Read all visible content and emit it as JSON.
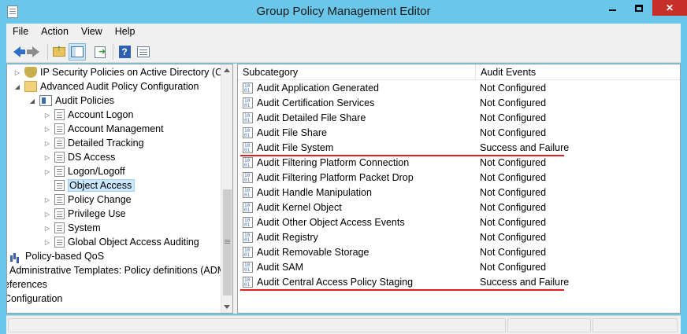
{
  "window": {
    "title": "Group Policy Management Editor"
  },
  "menu": [
    "File",
    "Action",
    "View",
    "Help"
  ],
  "toolbar": {
    "icons": [
      "back-arrow-icon",
      "forward-arrow-icon",
      "up-folder-icon",
      "show-hide-tree-icon",
      "export-list-icon",
      "help-icon",
      "properties-icon"
    ]
  },
  "tree": {
    "items": [
      {
        "label": "IP Security Policies on Active Directory (CO",
        "icon": "shield-icon",
        "expander": "▷"
      },
      {
        "label": "Advanced Audit Policy Configuration",
        "icon": "folder-icon",
        "expander": "◢"
      },
      {
        "label": "Audit Policies",
        "icon": "policy-icon",
        "expander": "◢"
      },
      {
        "label": "Account Logon",
        "icon": "document-icon",
        "expander": "▷"
      },
      {
        "label": "Account Management",
        "icon": "document-icon",
        "expander": "▷"
      },
      {
        "label": "Detailed Tracking",
        "icon": "document-icon",
        "expander": "▷"
      },
      {
        "label": "DS Access",
        "icon": "document-icon",
        "expander": "▷"
      },
      {
        "label": "Logon/Logoff",
        "icon": "document-icon",
        "expander": "▷"
      },
      {
        "label": "Object Access",
        "icon": "document-icon",
        "expander": ""
      },
      {
        "label": "Policy Change",
        "icon": "document-icon",
        "expander": "▷"
      },
      {
        "label": "Privilege Use",
        "icon": "document-icon",
        "expander": "▷"
      },
      {
        "label": "System",
        "icon": "document-icon",
        "expander": "▷"
      },
      {
        "label": "Global Object Access Auditing",
        "icon": "document-icon",
        "expander": "▷"
      },
      {
        "label": "Policy-based QoS",
        "icon": "chart-icon",
        "expander": ""
      },
      {
        "label": "Administrative Templates: Policy definitions (ADM",
        "icon": "",
        "expander": ""
      },
      {
        "label": "eferences",
        "icon": "",
        "expander": ""
      },
      {
        "label": "Configuration",
        "icon": "",
        "expander": ""
      }
    ]
  },
  "list": {
    "columns": [
      "Subcategory",
      "Audit Events"
    ],
    "rows": [
      {
        "name": "Audit Application Generated",
        "events": "Not Configured"
      },
      {
        "name": "Audit Certification Services",
        "events": "Not Configured"
      },
      {
        "name": "Audit Detailed File Share",
        "events": "Not Configured"
      },
      {
        "name": "Audit File Share",
        "events": "Not Configured"
      },
      {
        "name": "Audit File System",
        "events": "Success and Failure"
      },
      {
        "name": "Audit Filtering Platform Connection",
        "events": "Not Configured"
      },
      {
        "name": "Audit Filtering Platform Packet Drop",
        "events": "Not Configured"
      },
      {
        "name": "Audit Handle Manipulation",
        "events": "Not Configured"
      },
      {
        "name": "Audit Kernel Object",
        "events": "Not Configured"
      },
      {
        "name": "Audit Other Object Access Events",
        "events": "Not Configured"
      },
      {
        "name": "Audit Registry",
        "events": "Not Configured"
      },
      {
        "name": "Audit Removable Storage",
        "events": "Not Configured"
      },
      {
        "name": "Audit SAM",
        "events": "Not Configured"
      },
      {
        "name": "Audit Central Access Policy Staging",
        "events": "Success and Failure"
      }
    ]
  },
  "colors": {
    "window_frame": "#6bc7ea",
    "close_button": "#c7302a",
    "annotation_red": "#e02020",
    "selection": "#cce8ff"
  }
}
